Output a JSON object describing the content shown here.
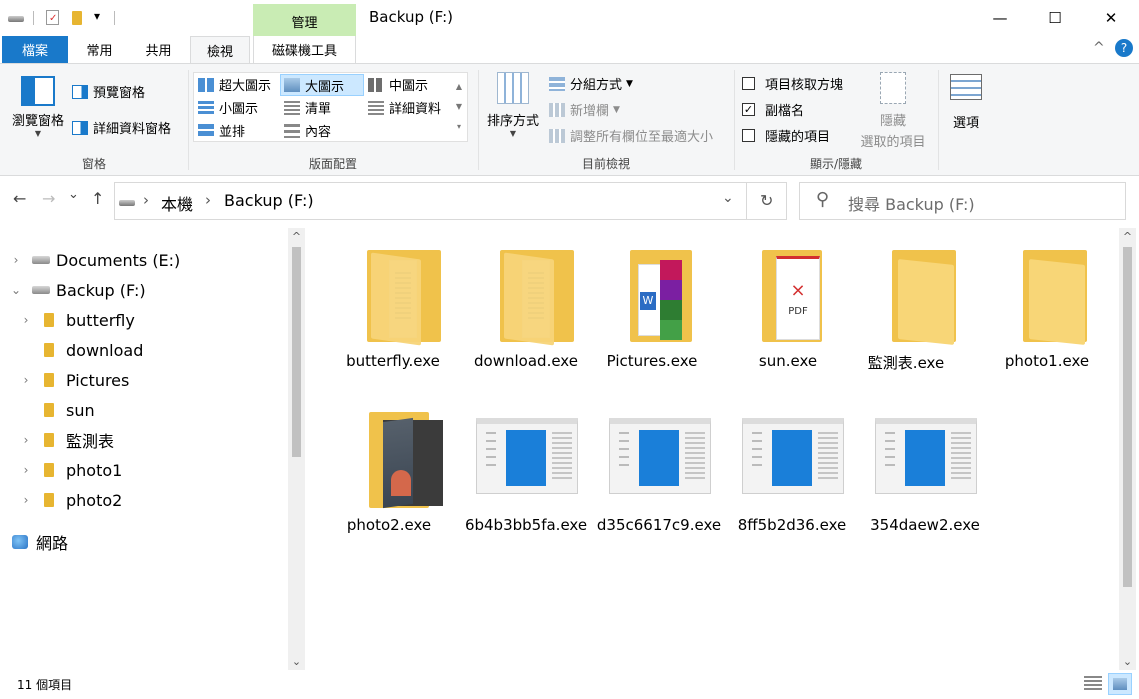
{
  "titlebar": {
    "manage_tab": "管理",
    "window_title": "Backup (F:)",
    "min_glyph": "—",
    "max_glyph": "☐",
    "close_glyph": "✕",
    "dropdown_glyph": "▾"
  },
  "ribbon_tabs": {
    "file": "檔案",
    "home": "常用",
    "share": "共用",
    "view": "檢視",
    "drive_tools": "磁碟機工具",
    "collapse_glyph": "^",
    "help_glyph": "?"
  },
  "ribbon": {
    "panes": {
      "nav_pane": "瀏覽窗格",
      "preview_pane": "預覽窗格",
      "details_pane": "詳細資料窗格",
      "group_label": "窗格"
    },
    "layout": {
      "extra_large": "超大圖示",
      "large": "大圖示",
      "medium": "中圖示",
      "small": "小圖示",
      "list": "清單",
      "details": "詳細資料",
      "tiles": "並排",
      "content": "內容",
      "group_label": "版面配置"
    },
    "current_view": {
      "sort_by": "排序方式",
      "group_by": "分組方式",
      "add_columns": "新增欄",
      "size_all_columns": "調整所有欄位至最適大小",
      "group_label": "目前檢視"
    },
    "show_hide": {
      "item_checkboxes": "項目核取方塊",
      "item_checkboxes_checked": false,
      "file_extensions": "副檔名",
      "file_extensions_checked": true,
      "hidden_items": "隱藏的項目",
      "hidden_items_checked": false,
      "hide_selected_1": "隱藏",
      "hide_selected_2": "選取的項目",
      "group_label": "顯示/隱藏"
    },
    "options": "選項",
    "check_glyph": "✓"
  },
  "address": {
    "back_glyph": "←",
    "forward_glyph": "→",
    "recent_glyph": "⌄",
    "up_glyph": "↑",
    "crumb_sep": "›",
    "crumbs": [
      "本機",
      "Backup (F:)"
    ],
    "refresh_glyph": "↻",
    "search_placeholder": "搜尋 Backup (F:)",
    "search_glyph": "⚲",
    "chevron_glyph": "⌄"
  },
  "nav_tree": {
    "drives": [
      "Documents (E:)",
      "Backup (F:)"
    ],
    "folders": [
      "butterfly",
      "download",
      "Pictures",
      "sun",
      "監測表",
      "photo1",
      "photo2"
    ],
    "network": "網路",
    "collapsed_glyph": "›",
    "expanded_glyph": "⌄",
    "scroll_up": "^",
    "scroll_down": "⌄"
  },
  "files": [
    {
      "name": "butterfly.exe",
      "icon": "folder-doc-icon"
    },
    {
      "name": "download.exe",
      "icon": "folder-doc-icon"
    },
    {
      "name": "Pictures.exe",
      "icon": "folder-word-icon"
    },
    {
      "name": "sun.exe",
      "icon": "folder-pdf-icon"
    },
    {
      "name": "監測表.exe",
      "icon": "folder-icon"
    },
    {
      "name": "photo1.exe",
      "icon": "folder-icon"
    },
    {
      "name": "photo2.exe",
      "icon": "folder-photo-icon"
    },
    {
      "name": "6b4b3bb5fa.exe",
      "icon": "app-window-icon"
    },
    {
      "name": "d35c6617c9.exe",
      "icon": "app-window-icon"
    },
    {
      "name": "8ff5b2d36.exe",
      "icon": "app-window-icon"
    },
    {
      "name": "354daew2.exe",
      "icon": "app-window-icon"
    }
  ],
  "status": {
    "item_count": "11 個項目"
  },
  "colors": {
    "accent": "#1979ca",
    "manage_tab": "#c9ecb4",
    "folder": "#f4c64e",
    "selected_layout": "#cce8ff"
  }
}
